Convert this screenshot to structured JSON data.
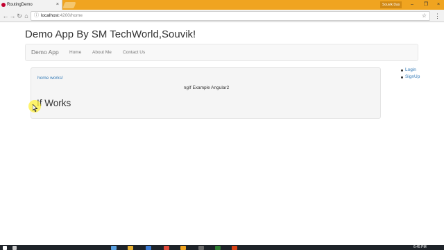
{
  "browser": {
    "tab_title": "RoutingDemo",
    "tab_close": "×",
    "user_name": "Souvik Das",
    "window_controls": {
      "minimize": "–",
      "maximize": "❐",
      "close": "×"
    },
    "url_host": "localhost",
    "url_path": ":4200/home",
    "icons": {
      "back": "back-arrow-icon",
      "forward": "forward-arrow-icon",
      "reload": "reload-icon",
      "home": "home-icon",
      "info": "info-icon",
      "star": "star-icon",
      "menu": "kebab-menu-icon"
    }
  },
  "page": {
    "title": "Demo App By SM TechWorld,Souvik!",
    "navbar": {
      "brand": "Demo App",
      "links": [
        "Home",
        "About Me",
        "Contact Us"
      ]
    },
    "content": {
      "home_works": "home works!",
      "ngif_label": "ngIf Example Angular2",
      "if_works": "If Works"
    },
    "side_links": [
      "Login",
      "SignUp"
    ]
  },
  "taskbar": {
    "time": "6:45 PM"
  },
  "colors": {
    "titlebar": "#f0a420",
    "link": "#337ab7",
    "navbar_bg": "#f8f8f8",
    "well_bg": "#f5f5f5",
    "taskbar": "#1e2329"
  }
}
